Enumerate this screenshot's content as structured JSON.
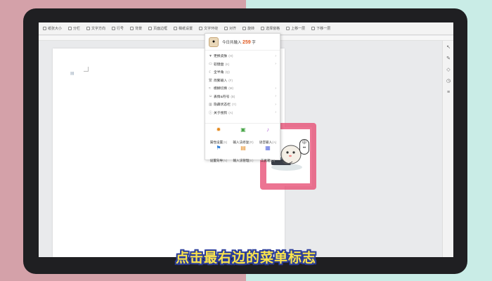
{
  "toolbar": {
    "items": [
      "纸张大小",
      "分栏",
      "文字方向",
      "行号",
      "背景",
      "页面边框",
      "稿纸设置",
      "文字环绕",
      "对齐",
      "旋转",
      "选择窗格",
      "上移一层",
      "下移一层"
    ]
  },
  "menu": {
    "header": {
      "prefix": "今日共输入",
      "count": "259",
      "suffix": "字"
    },
    "items": [
      {
        "label": "更换皮肤",
        "key": "(H)",
        "arrow": true,
        "icon": "shirt-icon"
      },
      {
        "label": "软键盘",
        "key": "(K)",
        "arrow": true,
        "icon": "keyboard-icon"
      },
      {
        "label": "全半角",
        "key": "(Q)",
        "arrow": false,
        "icon": "moon-icon"
      },
      {
        "label": "简繁输入",
        "key": "(F)",
        "arrow": false,
        "icon": "text-icon"
      },
      {
        "label": "模糊切换",
        "key": "(M)",
        "arrow": true,
        "icon": "fuzzy-icon"
      },
      {
        "label": "表情&符号",
        "key": "(B)",
        "arrow": true,
        "icon": "smile-icon"
      },
      {
        "label": "隐藏状态栏",
        "key": "(Y)",
        "arrow": true,
        "icon": "hide-icon"
      },
      {
        "label": "关于搜狗",
        "key": "(A)",
        "arrow": true,
        "icon": "info-icon"
      }
    ],
    "grid": [
      {
        "label": "属性设置",
        "key": "(S)",
        "icon": "gear-icon",
        "color": "#e58a1f"
      },
      {
        "label": "输入法修复",
        "key": "(R)",
        "icon": "lock-icon",
        "color": "#4aa64a"
      },
      {
        "label": "语音输入",
        "key": "(A)",
        "icon": "mic-icon",
        "color": "#b46bd6"
      },
      {
        "label": "设置向导",
        "key": "(N)",
        "icon": "flag-icon",
        "color": "#2f7fd8"
      },
      {
        "label": "输入法管理",
        "key": "(E)",
        "icon": "book-icon",
        "color": "#e58a1f"
      },
      {
        "label": "工具箱",
        "key": "(O)",
        "icon": "grid-icon",
        "color": "#5b6ee0"
      }
    ]
  },
  "mascot": {
    "speech_text": "中"
  },
  "caption": "点击最右边的菜单标志",
  "colors": {
    "caption_fill": "#fbe44b",
    "caption_stroke": "#2b3d9a",
    "highlight": "#e6466e",
    "count": "#e0581e"
  }
}
